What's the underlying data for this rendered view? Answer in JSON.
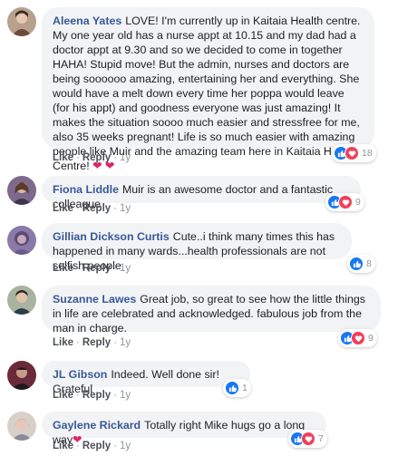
{
  "colors": {
    "author_link": "#385898",
    "bubble_bg": "#f2f3f5",
    "like_blue": "#1877f2",
    "love_red": "#f33e58"
  },
  "comments": [
    {
      "author": "Aleena Yates",
      "text": "LOVE! I'm currently up in Kaitaia Health centre. My one year old has a nurse appt at 10.15 and my dad had a doctor appt at 9.30 and so we decided to come in together HAHA! Stupid move! But the admin, nurses and doctors are being soooooo amazing, entertaining her and everything. She would have a melt down every time her poppa would leave (for his appt) and goodness everyone was just amazing! It makes the situation soooo much easier and stressfree for me, also 35 weeks pregnant! Life is so much easier with amazing people like Muir and the amazing team here in Kaitaia Health Centre!",
      "emoji": "❤ ❤",
      "like_label": "Like",
      "reply_label": "Reply",
      "time": "1y",
      "reaction_count": "18",
      "reactions": [
        "like-icon",
        "love-icon"
      ]
    },
    {
      "author": "Fiona Liddle",
      "text": "Muir is an awesome doctor and a fantastic colleague",
      "like_label": "Like",
      "reply_label": "Reply",
      "time": "1y",
      "reaction_count": "9",
      "reactions": [
        "like-icon",
        "love-icon"
      ]
    },
    {
      "author": "Gillian Dickson Curtis",
      "text": "Cute..i think many times this has happened in many wards...health professionals are not selfish people",
      "like_label": "Like",
      "reply_label": "Reply",
      "time": "1y",
      "reaction_count": "8",
      "reactions": [
        "like-icon"
      ]
    },
    {
      "author": "Suzanne Lawes",
      "text": "Great job, so great to see how the little things in life are celebrated and acknowledged. fabulous job from the man in charge.",
      "like_label": "Like",
      "reply_label": "Reply",
      "time": "1y",
      "reaction_count": "9",
      "reactions": [
        "like-icon",
        "love-icon"
      ]
    },
    {
      "author": "JL Gibson",
      "text": "Indeed. Well done sir! Grateful",
      "like_label": "Like",
      "reply_label": "Reply",
      "time": "1y",
      "reaction_count": "1",
      "reactions": [
        "like-icon"
      ]
    },
    {
      "author": "Gaylene Rickard",
      "text": "Totally right Mike hugs go a long way",
      "emoji": "❤",
      "like_label": "Like",
      "reply_label": "Reply",
      "time": "1y",
      "reaction_count": "7",
      "reactions": [
        "like-icon",
        "love-icon"
      ]
    }
  ]
}
